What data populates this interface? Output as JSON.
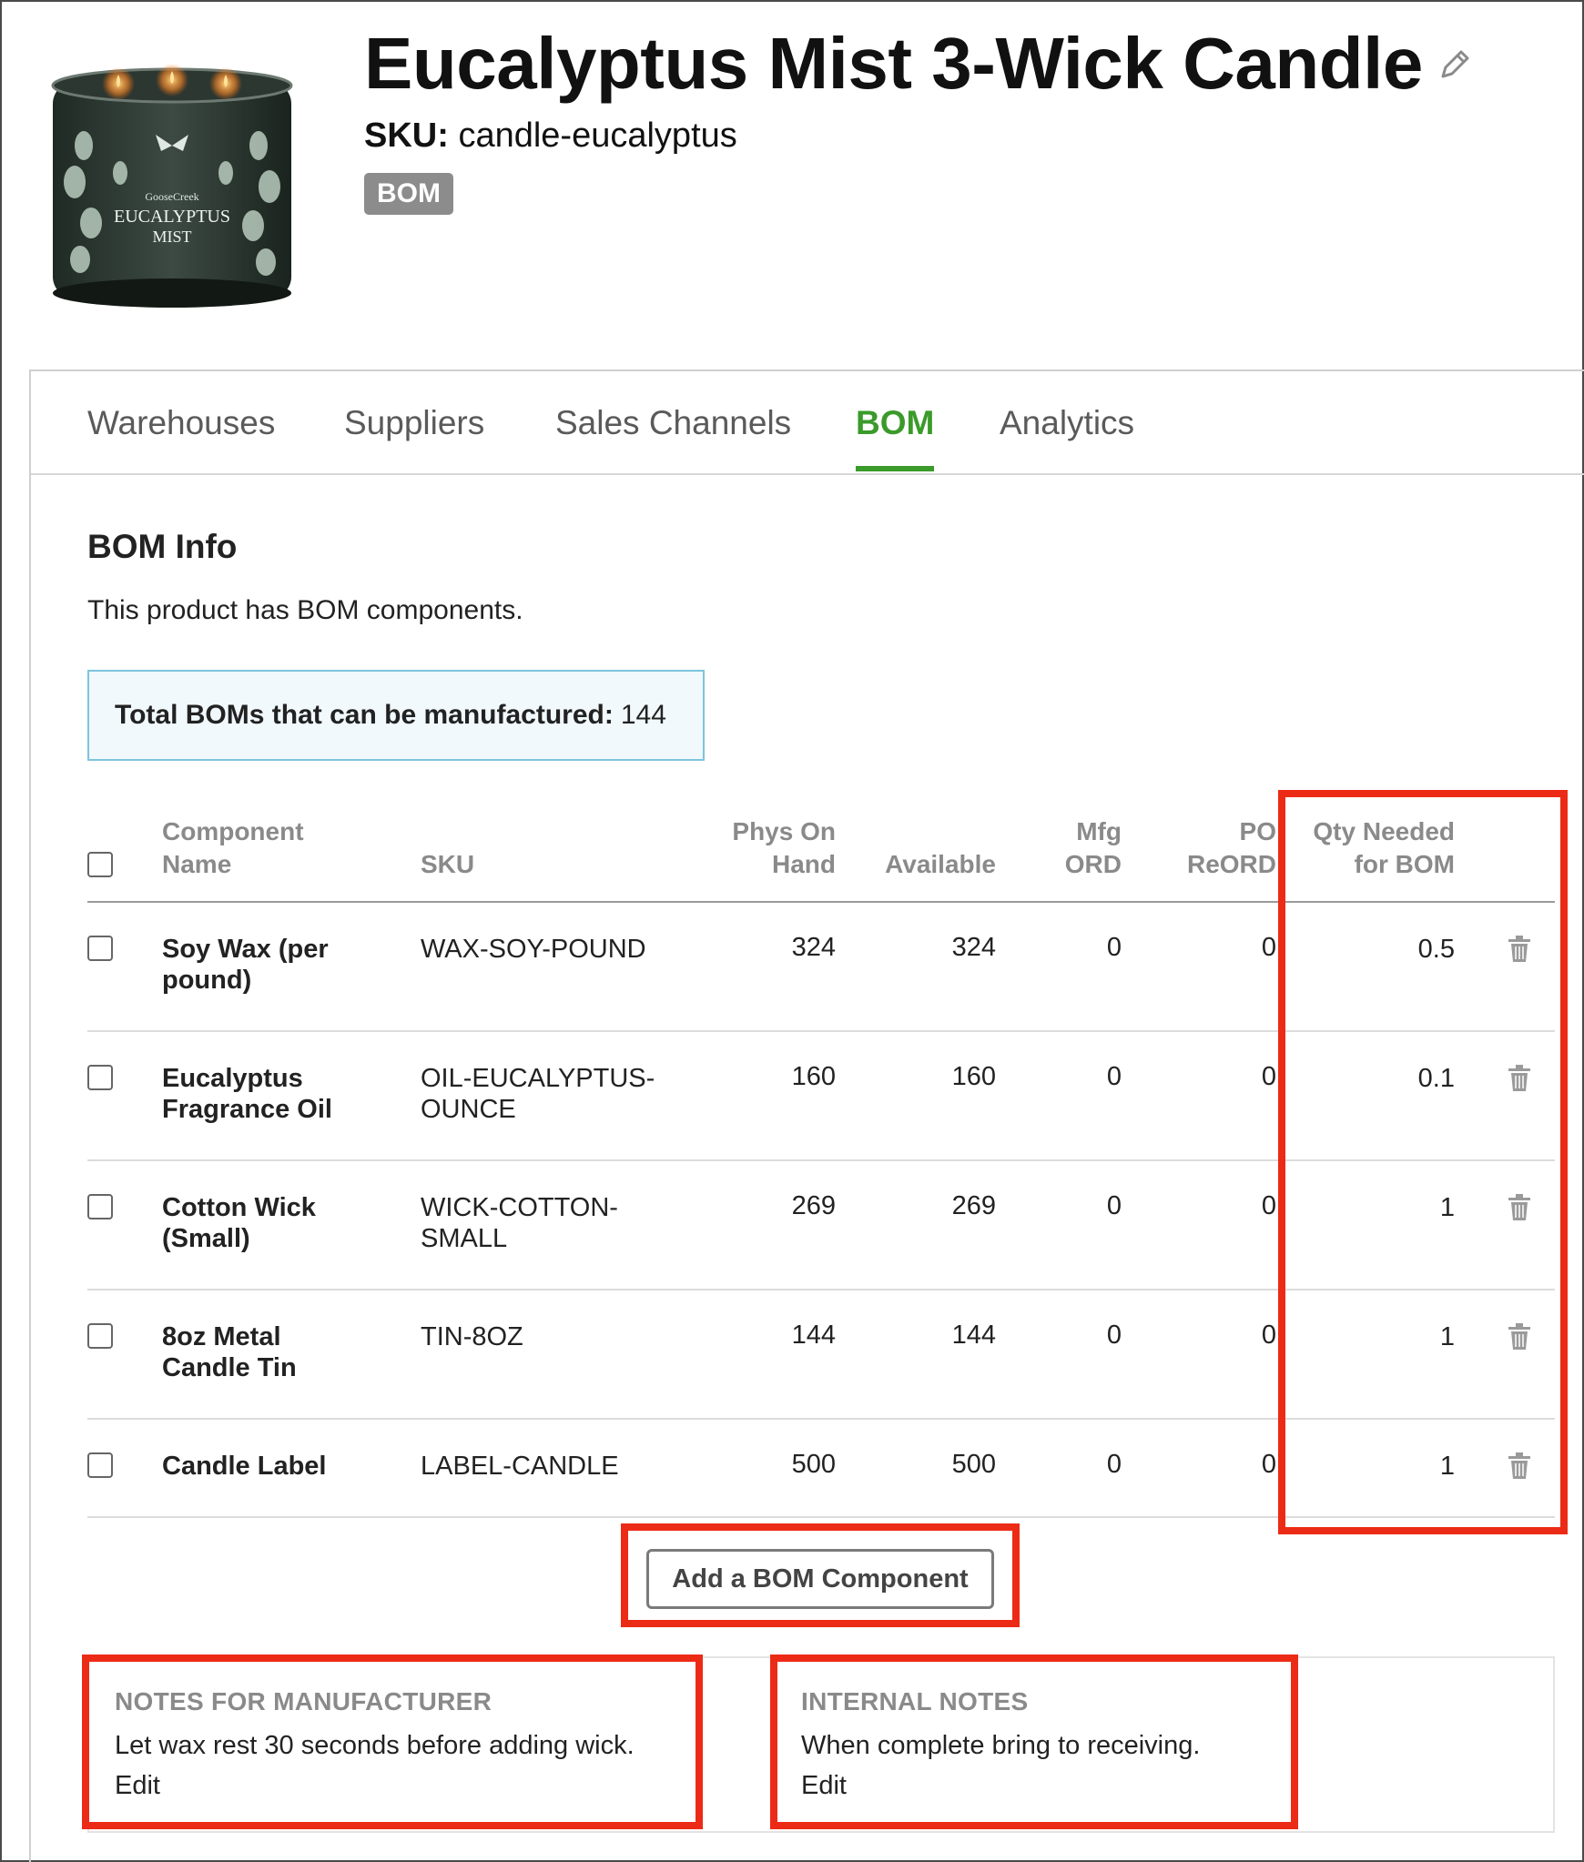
{
  "product": {
    "title": "Eucalyptus Mist 3-Wick Candle",
    "sku_label": "SKU:",
    "sku_value": "candle-eucalyptus",
    "badge": "BOM",
    "image_brand": "GooseCreek",
    "image_line1": "EUCALYPTUS",
    "image_line2": "MIST"
  },
  "tabs": [
    {
      "label": "Warehouses",
      "active": false
    },
    {
      "label": "Suppliers",
      "active": false
    },
    {
      "label": "Sales Channels",
      "active": false
    },
    {
      "label": "BOM",
      "active": true
    },
    {
      "label": "Analytics",
      "active": false
    }
  ],
  "bom": {
    "title": "BOM Info",
    "description": "This product has BOM components.",
    "total_label": "Total BOMs that can be manufactured:",
    "total_value": "144",
    "columns": {
      "name_1": "Component",
      "name_2": "Name",
      "sku": "SKU",
      "phys_1": "Phys On",
      "phys_2": "Hand",
      "available": "Available",
      "mfg_1": "Mfg",
      "mfg_2": "ORD",
      "po_1": "PO",
      "po_2": "ReORD",
      "qty_1": "Qty Needed",
      "qty_2": "for BOM"
    },
    "rows": [
      {
        "name_1": "Soy Wax (per",
        "name_2": "pound)",
        "sku_1": "WAX-SOY-POUND",
        "sku_2": "",
        "phys": "324",
        "available": "324",
        "mfg": "0",
        "po": "0",
        "qty": "0.5"
      },
      {
        "name_1": "Eucalyptus",
        "name_2": "Fragrance Oil",
        "sku_1": "OIL-EUCALYPTUS-",
        "sku_2": "OUNCE",
        "phys": "160",
        "available": "160",
        "mfg": "0",
        "po": "0",
        "qty": "0.1"
      },
      {
        "name_1": "Cotton Wick",
        "name_2": "(Small)",
        "sku_1": "WICK-COTTON-",
        "sku_2": "SMALL",
        "phys": "269",
        "available": "269",
        "mfg": "0",
        "po": "0",
        "qty": "1"
      },
      {
        "name_1": "8oz Metal",
        "name_2": "Candle Tin",
        "sku_1": "TIN-8OZ",
        "sku_2": "",
        "phys": "144",
        "available": "144",
        "mfg": "0",
        "po": "0",
        "qty": "1"
      },
      {
        "name_1": "Candle Label",
        "name_2": "",
        "sku_1": "LABEL-CANDLE",
        "sku_2": "",
        "phys": "500",
        "available": "500",
        "mfg": "0",
        "po": "0",
        "qty": "1"
      }
    ],
    "add_button": "Add a BOM Component"
  },
  "notes": {
    "manufacturer_label": "NOTES FOR MANUFACTURER",
    "manufacturer_text": "Let wax rest 30 seconds before adding wick.",
    "manufacturer_edit": "Edit",
    "internal_label": "INTERNAL NOTES",
    "internal_text": "When complete bring to receiving.",
    "internal_edit": "Edit"
  },
  "colors": {
    "accent_green": "#3a9a2a",
    "highlight_red": "#ec2b17",
    "badge_gray": "#8c8c8c",
    "info_border": "#7ec4dd"
  }
}
